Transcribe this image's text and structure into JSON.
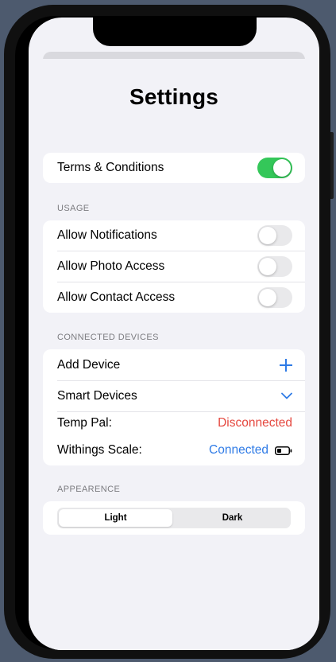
{
  "screen": {
    "title": "Settings"
  },
  "terms": {
    "label": "Terms & Conditions",
    "on": true
  },
  "usage": {
    "header": "USAGE",
    "items": [
      {
        "label": "Allow Notifications",
        "on": false
      },
      {
        "label": "Allow Photo Access",
        "on": false
      },
      {
        "label": "Allow Contact Access",
        "on": false
      }
    ]
  },
  "devices": {
    "header": "CONNECTED DEVICES",
    "add_label": "Add Device",
    "smart_label": "Smart Devices",
    "list": [
      {
        "name": "Temp Pal:",
        "status": "Disconnected"
      },
      {
        "name": "Withings Scale:",
        "status": "Connected"
      }
    ]
  },
  "appearance": {
    "header": "APPEARENCE",
    "options": [
      "Light",
      "Dark"
    ],
    "selected": "Light"
  },
  "colors": {
    "toggle_on": "#34c759",
    "accent_blue": "#2f7be6",
    "disconnected_red": "#e5473e"
  },
  "icons": {
    "add": "plus-icon",
    "expand": "chevron-down-icon",
    "battery": "battery-low-icon"
  }
}
